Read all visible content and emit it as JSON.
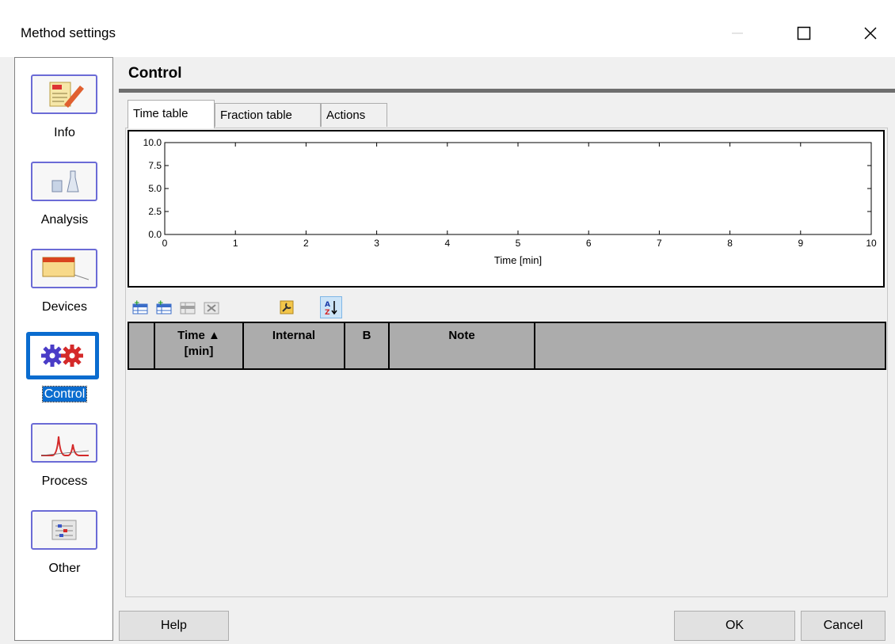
{
  "window": {
    "title": "Method settings"
  },
  "sidebar": {
    "items": [
      {
        "label": "Info",
        "icon": "notepad-pen-icon"
      },
      {
        "label": "Analysis",
        "icon": "beaker-flask-icon"
      },
      {
        "label": "Devices",
        "icon": "device-module-icon"
      },
      {
        "label": "Control",
        "icon": "gears-icon",
        "selected": true
      },
      {
        "label": "Process",
        "icon": "chromatogram-peaks-icon"
      },
      {
        "label": "Other",
        "icon": "settings-sliders-icon"
      }
    ]
  },
  "section": {
    "title": "Control"
  },
  "tabs": [
    {
      "label": "Time table",
      "active": true
    },
    {
      "label": "Fraction table",
      "active": false
    },
    {
      "label": "Actions",
      "active": false
    }
  ],
  "chart_data": {
    "type": "line",
    "xlabel": "Time [min]",
    "xlim": [
      0,
      10
    ],
    "ylim": [
      0,
      10
    ],
    "x_ticks": [
      "0",
      "1",
      "2",
      "3",
      "4",
      "5",
      "6",
      "7",
      "8",
      "9",
      "10"
    ],
    "y_ticks": [
      "0.0",
      "2.5",
      "5.0",
      "7.5",
      "10.0"
    ],
    "series": []
  },
  "toolbar": {
    "buttons": [
      "insert-row-icon",
      "append-row-icon",
      "insert-row-disabled-icon",
      "delete-row-disabled-icon",
      "wrench-icon",
      "sort-az-icon"
    ]
  },
  "table": {
    "columns": [
      {
        "line1": "Time ▲",
        "line2": "[min]"
      },
      {
        "line1": "Internal",
        "line2": ""
      },
      {
        "line1": "B",
        "line2": ""
      },
      {
        "line1": "Note",
        "line2": ""
      }
    ],
    "rows": []
  },
  "footer": {
    "help": "Help",
    "ok": "OK",
    "cancel": "Cancel"
  },
  "colors": {
    "selection": "#0a6ccf",
    "icon_border": "#6b6bd6",
    "grid_header": "#acacac"
  }
}
